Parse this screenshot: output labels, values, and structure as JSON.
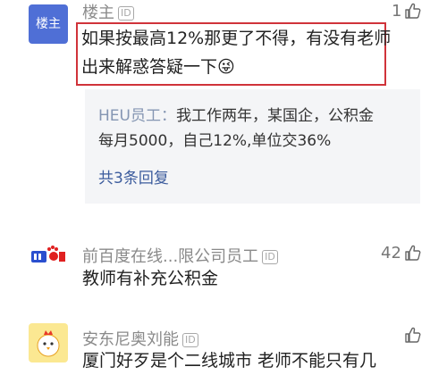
{
  "comments": [
    {
      "avatar_text": "楼主",
      "username": "楼主",
      "id_badge": "ID",
      "likes": "1",
      "content_line1": "如果按最高12%那更了不得，有没有老师",
      "content_line2": "出来解惑答疑一下",
      "emoji": "😜",
      "reply": {
        "name": "HEU员工：",
        "text_line1": "我工作两年，某国企，公积金",
        "text_line2": "每月5000，自己12%,单位交36%",
        "more": "共3条回复"
      }
    },
    {
      "avatar_icon": "baidu-logo-icon",
      "username": "前百度在线...限公司员工",
      "id_badge": "ID",
      "likes": "42",
      "content": "教师有补充公积金"
    },
    {
      "avatar_icon": "chick-avatar-icon",
      "username": "安东尼奥刘能",
      "id_badge": "ID",
      "content": "厦门好歹是个二线城市 老师不能只有几"
    }
  ],
  "colors": {
    "highlight_border": "#d0333a",
    "avatar_blue": "#4f6fd6",
    "link_blue": "#3c5c9d"
  }
}
